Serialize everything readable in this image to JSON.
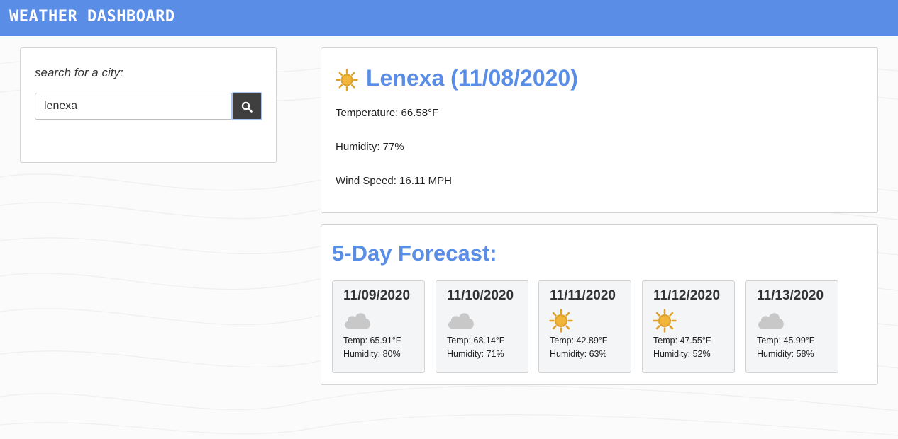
{
  "header": {
    "title": "WEATHER DASHBOARD"
  },
  "search": {
    "label": "search for a city:",
    "value": "lenexa",
    "button_icon": "search-icon"
  },
  "current": {
    "icon": "sun-icon",
    "title": "Lenexa (11/08/2020)",
    "temperature": "Temperature: 66.58°F",
    "humidity": "Humidity: 77%",
    "wind": "Wind Speed: 16.11 MPH"
  },
  "forecast": {
    "title": "5-Day Forecast:",
    "days": [
      {
        "date": "11/09/2020",
        "icon": "cloud-icon",
        "temp": "Temp: 65.91°F",
        "humidity": "Humidity: 80%"
      },
      {
        "date": "11/10/2020",
        "icon": "cloud-icon",
        "temp": "Temp: 68.14°F",
        "humidity": "Humidity: 71%"
      },
      {
        "date": "11/11/2020",
        "icon": "sun-icon",
        "temp": "Temp: 42.89°F",
        "humidity": "Humidity: 63%"
      },
      {
        "date": "11/12/2020",
        "icon": "sun-icon",
        "temp": "Temp: 47.55°F",
        "humidity": "Humidity: 52%"
      },
      {
        "date": "11/13/2020",
        "icon": "cloud-icon",
        "temp": "Temp: 45.99°F",
        "humidity": "Humidity: 58%"
      }
    ]
  },
  "colors": {
    "header_bg": "#5a8de6",
    "accent": "#5a8de6",
    "sun": "#e0a02a",
    "cloud": "#c8c8c8",
    "button_bg": "#3f3f3f"
  }
}
